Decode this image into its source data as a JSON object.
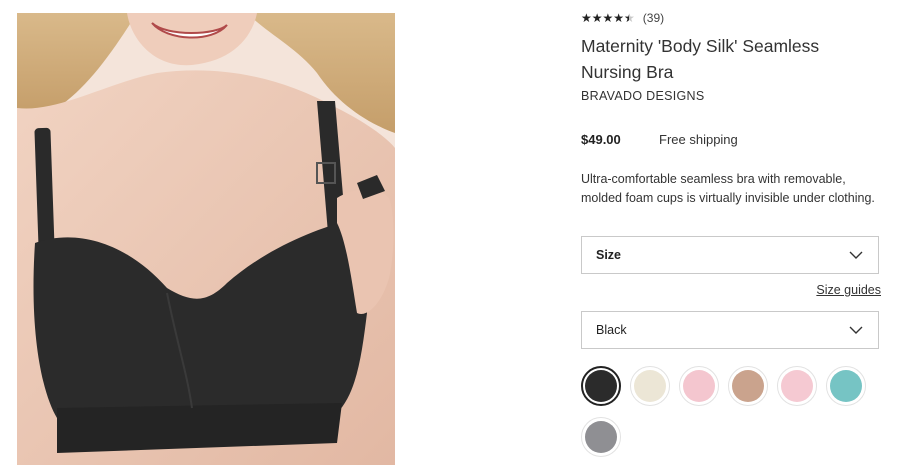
{
  "product": {
    "rating_value": 4.5,
    "rating_stars": "★★★★★",
    "review_count": "(39)",
    "title": "Maternity 'Body Silk' Seamless Nursing Bra",
    "brand": "BRAVADO DESIGNS",
    "price": "$49.00",
    "shipping": "Free shipping",
    "description": "Ultra-comfortable seamless bra with removable, molded foam cups is virtually invisible under clothing."
  },
  "size_select": {
    "label": "Size",
    "icon": "chevron-down-icon"
  },
  "size_guides_link": "Size guides",
  "color_select": {
    "value": "Black",
    "icon": "chevron-down-icon"
  },
  "swatches": [
    {
      "name": "black",
      "color": "#2b2b2b",
      "selected": true
    },
    {
      "name": "cream",
      "color": "#ece6d6",
      "selected": false
    },
    {
      "name": "light-pink",
      "color": "#f4c6cf",
      "selected": false
    },
    {
      "name": "tan",
      "color": "#caa38d",
      "selected": false
    },
    {
      "name": "pink",
      "color": "#f5c9d2",
      "selected": false
    },
    {
      "name": "teal",
      "color": "#76c4c4",
      "selected": false
    },
    {
      "name": "grey",
      "color": "#8f8f93",
      "selected": false
    }
  ],
  "image": {
    "icon": "product-photo",
    "alt_subject": "model wearing black nursing bra"
  }
}
